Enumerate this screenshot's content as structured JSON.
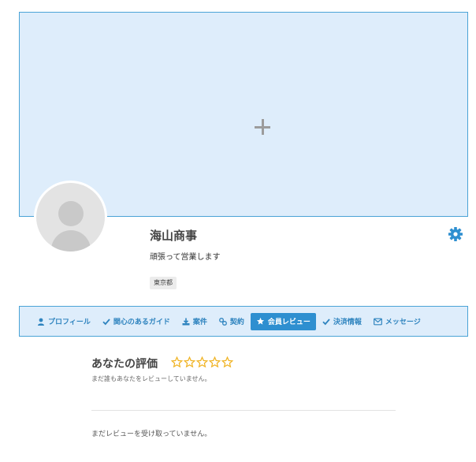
{
  "cover": {
    "add_icon": "plus-icon"
  },
  "profile": {
    "avatar_icon": "user-silhouette-icon",
    "company_name": "海山商事",
    "tagline": "頑張って営業します",
    "location": "東京都",
    "settings_icon": "gear-icon"
  },
  "tabs": [
    {
      "label": "プロフィール",
      "icon": "user-icon",
      "active": false
    },
    {
      "label": "関心のあるガイド",
      "icon": "check-icon",
      "active": false
    },
    {
      "label": "案件",
      "icon": "download-icon",
      "active": false
    },
    {
      "label": "契約",
      "icon": "link-icon",
      "active": false
    },
    {
      "label": "会員レビュー",
      "icon": "star-icon",
      "active": true
    },
    {
      "label": "決済情報",
      "icon": "check-icon",
      "active": false
    },
    {
      "label": "メッセージ",
      "icon": "envelope-icon",
      "active": false
    }
  ],
  "rating": {
    "title": "あなたの評価",
    "stars_filled": 0,
    "stars_total": 5,
    "note": "まだ誰もあなたをレビューしていません。"
  },
  "reviews": {
    "empty_text": "まだレビューを受け取っていません。"
  },
  "colors": {
    "accent": "#2e8fd0",
    "cover_bg": "#deedfb",
    "border": "#4aa3d6",
    "star": "#f0b323"
  }
}
